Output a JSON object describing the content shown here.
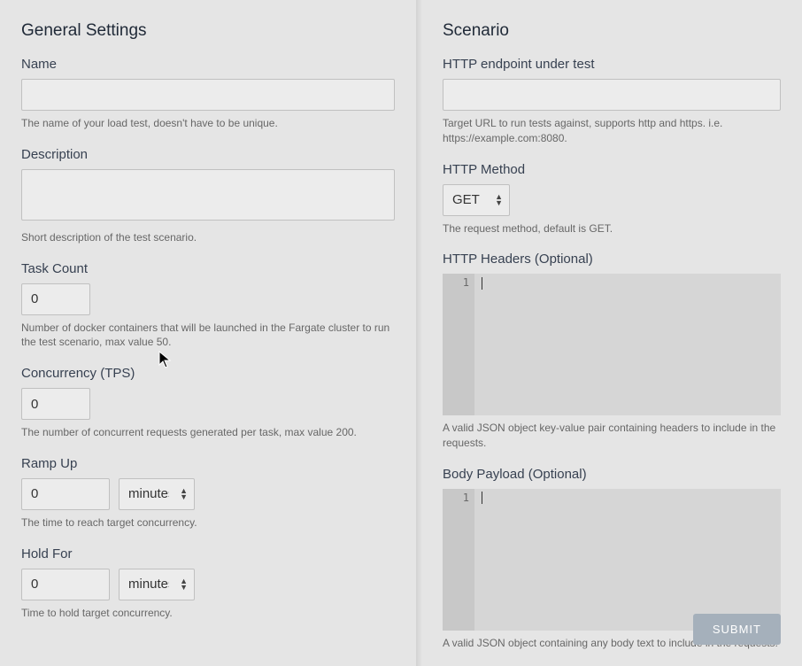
{
  "general": {
    "title": "General Settings",
    "name": {
      "label": "Name",
      "value": "",
      "help": "The name of your load test, doesn't have to be unique."
    },
    "description": {
      "label": "Description",
      "value": "",
      "help": "Short description of the test scenario."
    },
    "task_count": {
      "label": "Task Count",
      "value": "0",
      "help": "Number of docker containers that will be launched in the Fargate cluster to run the test scenario, max value 50."
    },
    "concurrency": {
      "label": "Concurrency (TPS)",
      "value": "0",
      "help": "The number of concurrent requests generated per task, max value 200."
    },
    "ramp_up": {
      "label": "Ramp Up",
      "value": "0",
      "unit_selected": "minutes",
      "help": "The time to reach target concurrency."
    },
    "hold_for": {
      "label": "Hold For",
      "value": "0",
      "unit_selected": "minutes",
      "help": "Time to hold target concurrency."
    }
  },
  "scenario": {
    "title": "Scenario",
    "endpoint": {
      "label": "HTTP endpoint under test",
      "value": "",
      "help": "Target URL to run tests against, supports http and https. i.e. https://example.com:8080."
    },
    "method": {
      "label": "HTTP Method",
      "selected": "GET",
      "help": "The request method, default is GET."
    },
    "headers": {
      "label": "HTTP Headers (Optional)",
      "line_number": "1",
      "value": "",
      "help": "A valid JSON object key-value pair containing headers to include in the requests."
    },
    "body": {
      "label": "Body Payload (Optional)",
      "line_number": "1",
      "value": "",
      "help": "A valid JSON object containing any body text to include in the requests."
    },
    "submit_label": "SUBMIT"
  }
}
